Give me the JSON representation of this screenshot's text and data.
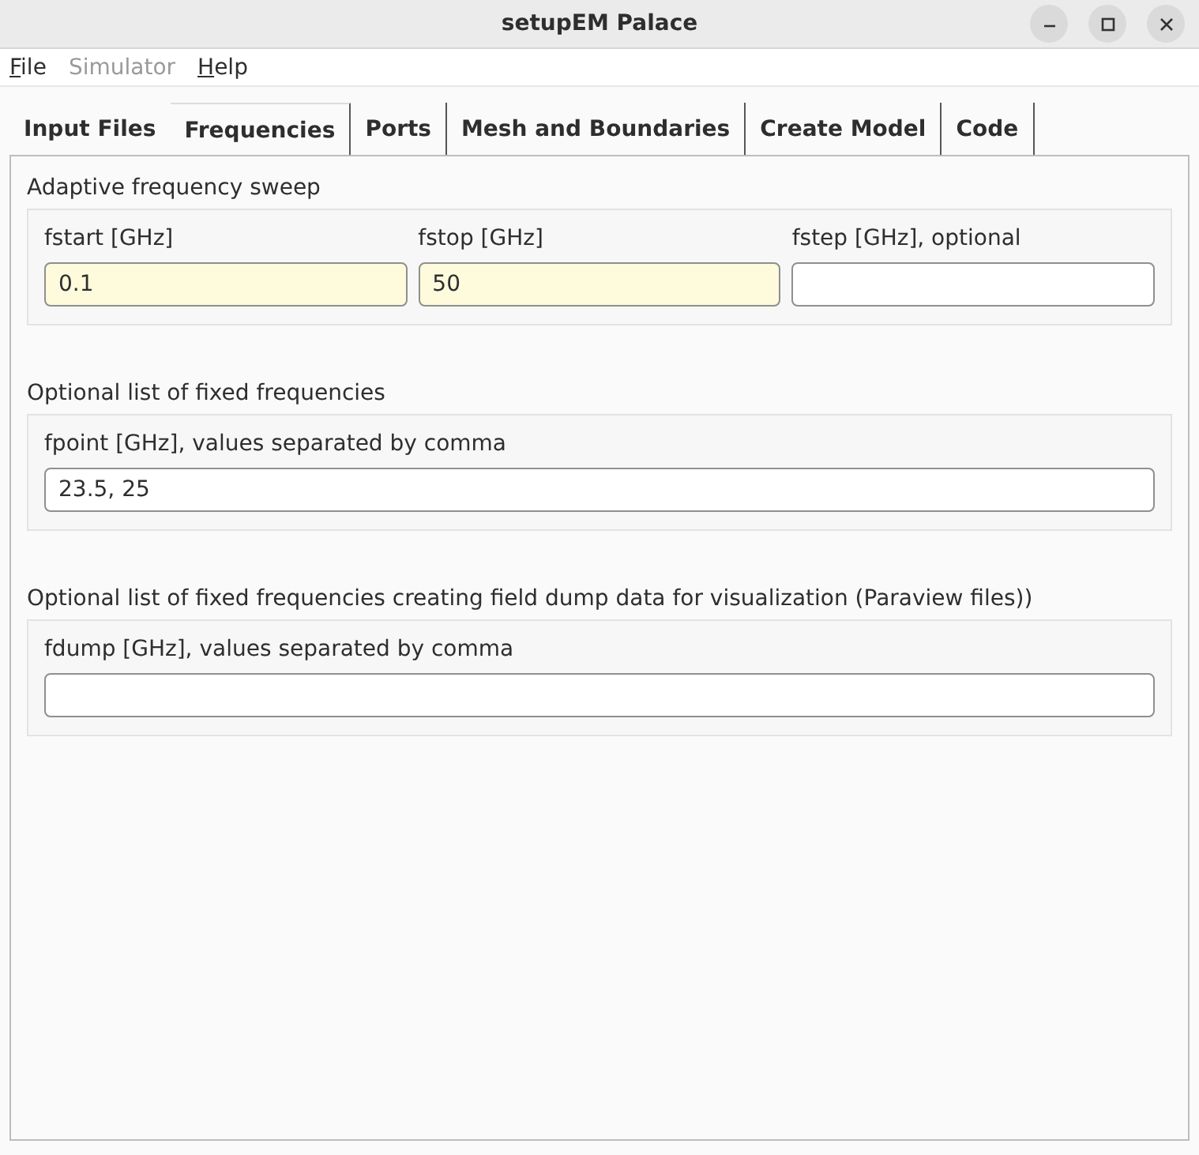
{
  "window": {
    "title": "setupEM Palace",
    "controls": [
      {
        "kind": "minimize"
      },
      {
        "kind": "maximize"
      },
      {
        "kind": "close"
      }
    ]
  },
  "menu": [
    {
      "label": "File",
      "disabled": false,
      "mnemonic": true
    },
    {
      "label": "Simulator",
      "disabled": true,
      "mnemonic": false
    },
    {
      "label": "Help",
      "disabled": false,
      "mnemonic": true
    }
  ],
  "tabs": [
    {
      "label": "Input Files",
      "selected": false
    },
    {
      "label": "Frequencies",
      "selected": true
    },
    {
      "label": "Ports",
      "selected": false
    },
    {
      "label": "Mesh and Boundaries",
      "selected": false
    },
    {
      "label": "Create Model",
      "selected": false
    },
    {
      "label": "Code",
      "selected": false
    }
  ],
  "groups": [
    {
      "title": "Adaptive frequency sweep",
      "fields": [
        {
          "label": "fstart [GHz]",
          "value": "0.1",
          "highlighted": true
        },
        {
          "label": "fstop [GHz]",
          "value": "50",
          "highlighted": true
        },
        {
          "label": "fstep [GHz], optional",
          "highlighted": false
        }
      ]
    },
    {
      "title": "Optional list of fixed frequencies",
      "fields": [
        {
          "label": "fpoint [GHz], values separated by comma",
          "value": "23.5, 25",
          "highlighted": false
        }
      ]
    },
    {
      "title": "Optional list of fixed frequencies creating field dump data for visualization (Paraview files))",
      "fields": [
        {
          "label": "fdump [GHz], values separated by comma",
          "highlighted": false
        }
      ]
    }
  ]
}
